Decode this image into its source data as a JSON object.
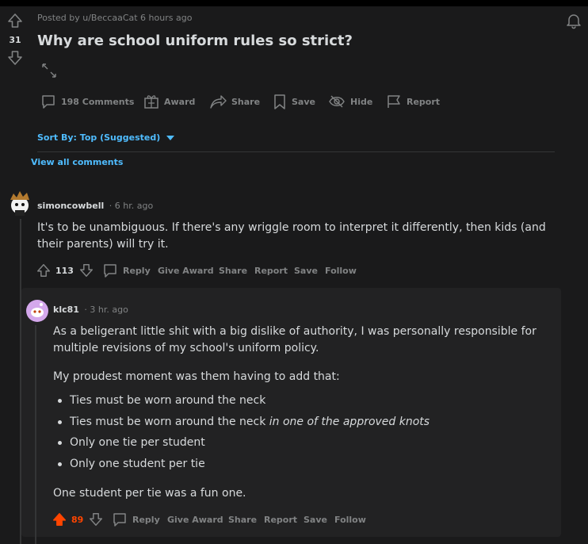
{
  "post": {
    "score": "31",
    "meta": "Posted by u/BeccaaCat 6 hours ago",
    "title": "Why are school uniform rules so strict?",
    "actions": {
      "comments": "198 Comments",
      "award": "Award",
      "share": "Share",
      "save": "Save",
      "hide": "Hide",
      "report": "Report"
    }
  },
  "sort": {
    "label": "Sort By: Top (Suggested)"
  },
  "view_all": "View all comments",
  "comments": [
    {
      "author": "simoncowbell",
      "time": "· 6 hr. ago",
      "body": "It's to be unambiguous. If there's any wriggle room to interpret it differently, then kids (and their parents) will try it.",
      "score": "113",
      "actions": {
        "reply": "Reply",
        "give_award": "Give Award",
        "share": "Share",
        "report": "Report",
        "save": "Save",
        "follow": "Follow"
      }
    },
    {
      "author": "klc81",
      "time": "· 3 hr. ago",
      "para1": "As a beligerant little shit with a big dislike of authority, I was personally responsible for multiple revisions of my school's uniform policy.",
      "para2": "My proudest moment was them having to add that:",
      "list": [
        {
          "text": "Ties must be worn around the neck",
          "italic": ""
        },
        {
          "text": "Ties must be worn around the neck ",
          "italic": "in one of the approved knots"
        },
        {
          "text": "Only one tie per student",
          "italic": ""
        },
        {
          "text": "Only one student per tie",
          "italic": ""
        }
      ],
      "para3": "One student per tie was a fun one.",
      "score": "89",
      "actions": {
        "reply": "Reply",
        "give_award": "Give Award",
        "share": "Share",
        "report": "Report",
        "save": "Save",
        "follow": "Follow"
      }
    }
  ],
  "colors": {
    "upvoted": "#ff4500",
    "link": "#4fbcff",
    "text": "#d7dadc",
    "muted": "#818384"
  }
}
